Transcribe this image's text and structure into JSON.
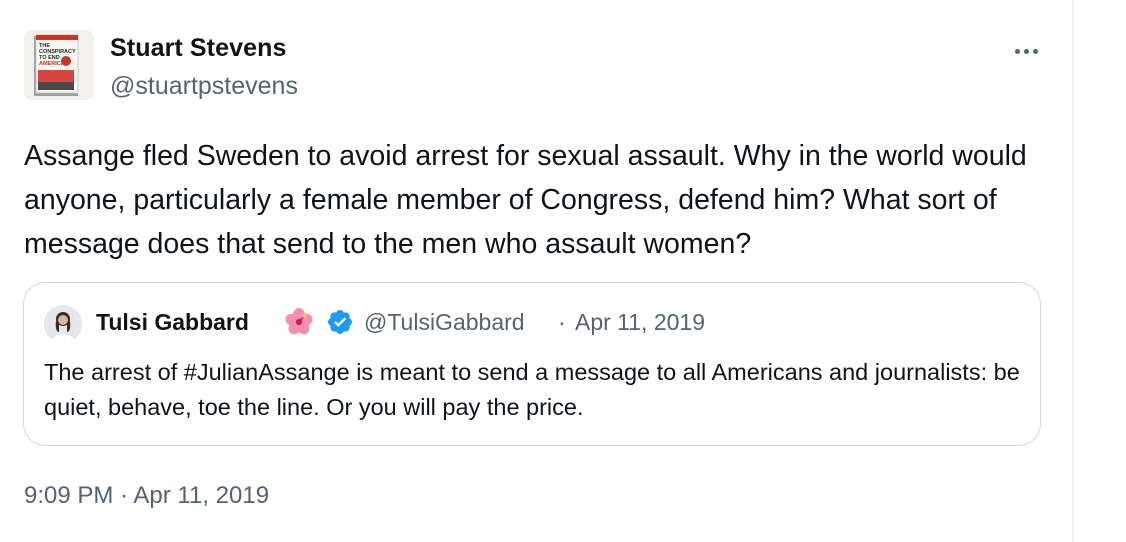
{
  "author": {
    "display_name": "Stuart Stevens",
    "handle": "@stuartpstevens",
    "avatar_icon": "book-cover-avatar"
  },
  "tweet": {
    "text": "Assange fled Sweden to avoid arrest for sexual assault. Why in the world would anyone, particularly a female member of Congress, defend him? What sort of message does that send to the men who assault women?",
    "time": "9:09 PM",
    "separator": "·",
    "date": "Apr 11, 2019"
  },
  "quoted_tweet": {
    "display_name": "Tulsi Gabbard",
    "emoji_icon": "hibiscus-flower-icon",
    "verified_icon": "verified-badge-icon",
    "handle": "@TulsiGabbard",
    "separator": "·",
    "date": "Apr 11, 2019",
    "text": "The arrest of #JulianAssange is meant to send a message to all Americans and journalists: be quiet, behave, toe the line. Or you will pay the price."
  },
  "colors": {
    "text_primary": "#0f1419",
    "text_secondary": "#536471",
    "border": "#cfd9de",
    "verified_blue": "#1d9bf0"
  }
}
